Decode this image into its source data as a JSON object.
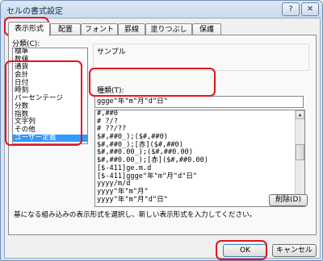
{
  "window": {
    "title": "セルの書式設定",
    "help_label": "?",
    "close_label": "✕"
  },
  "tabs": [
    {
      "label": "表示形式"
    },
    {
      "label": "配置"
    },
    {
      "label": "フォント"
    },
    {
      "label": "罫線"
    },
    {
      "label": "塗りつぶし"
    },
    {
      "label": "保護"
    }
  ],
  "category": {
    "label": "分類(C):",
    "items": [
      "標準",
      "数値",
      "通貨",
      "会計",
      "日付",
      "時刻",
      "パーセンテージ",
      "分数",
      "指数",
      "文字列",
      "その他",
      "ユーザー定義"
    ],
    "selected": "ユーザー定義"
  },
  "sample": {
    "label": "サンプル",
    "value": ""
  },
  "type": {
    "label": "種類(T):",
    "value": "ggge\"年\"m\"月\"d\"日\"",
    "items": [
      "#,##0",
      "# ?/?",
      "# ??/??",
      "$#,##0_);($#,##0)",
      "$#,##0_);[赤]($#,##0)",
      "$#,##0.00_);($#,##0.00)",
      "$#,##0.00_);[赤]($#,##0.00)",
      "[$-411]ge.m.d",
      "[$-411]ggge\"年\"m\"月\"d\"日\"",
      "yyyy/m/d",
      "yyyy\"年\"m\"月\"",
      "yyyy\"年\"m\"月\"d\"日\""
    ]
  },
  "delete_button": "削除(D)",
  "description": "基になる組み込みの表示形式を選択し、新しい表示形式を入力してください。",
  "footer": {
    "ok": "OK",
    "cancel": "キャンセル"
  },
  "colors": {
    "highlight": "#e5121d",
    "selection": "#3399ff"
  }
}
